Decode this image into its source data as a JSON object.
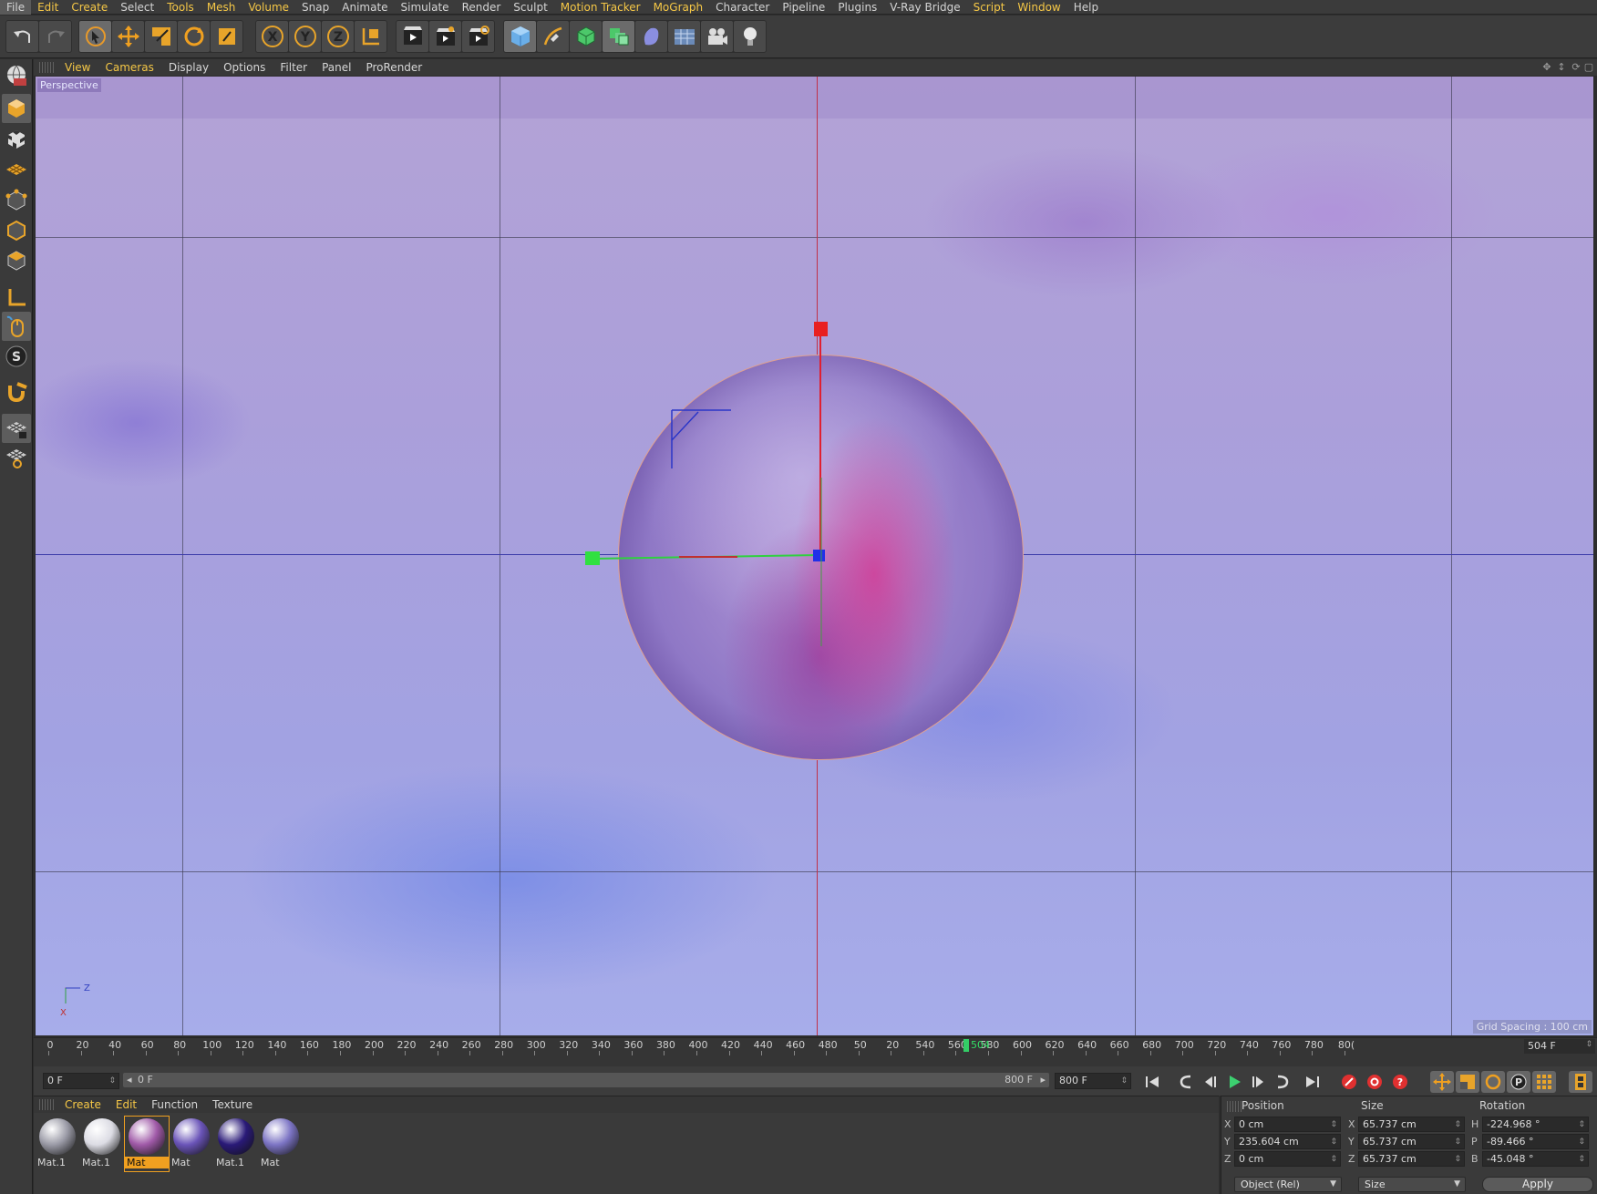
{
  "menubar": {
    "items": [
      {
        "label": "File",
        "hl": false
      },
      {
        "label": "Edit",
        "hl": true
      },
      {
        "label": "Create",
        "hl": true
      },
      {
        "label": "Select",
        "hl": false
      },
      {
        "label": "Tools",
        "hl": true
      },
      {
        "label": "Mesh",
        "hl": true
      },
      {
        "label": "Volume",
        "hl": true
      },
      {
        "label": "Snap",
        "hl": false
      },
      {
        "label": "Animate",
        "hl": false
      },
      {
        "label": "Simulate",
        "hl": false
      },
      {
        "label": "Render",
        "hl": false
      },
      {
        "label": "Sculpt",
        "hl": false
      },
      {
        "label": "Motion Tracker",
        "hl": true
      },
      {
        "label": "MoGraph",
        "hl": true
      },
      {
        "label": "Character",
        "hl": false
      },
      {
        "label": "Pipeline",
        "hl": false
      },
      {
        "label": "Plugins",
        "hl": false
      },
      {
        "label": "V-Ray Bridge",
        "hl": false
      },
      {
        "label": "Script",
        "hl": true
      },
      {
        "label": "Window",
        "hl": true
      },
      {
        "label": "Help",
        "hl": false
      }
    ]
  },
  "toolbar": {
    "icons": [
      "undo-icon",
      "redo-icon",
      "live-selection-icon",
      "move-icon",
      "scale-icon",
      "rotate-icon",
      "recent-tool-icon",
      "x-axis-lock-icon",
      "y-axis-lock-icon",
      "z-axis-lock-icon",
      "coordinate-system-icon",
      "render-view-icon",
      "render-picture-viewer-icon",
      "render-settings-icon",
      "cube-icon",
      "pen-icon",
      "subdivision-icon",
      "array-icon",
      "deformer-icon",
      "floor-icon",
      "camera-icon",
      "light-icon"
    ]
  },
  "viewport": {
    "menus": [
      "View",
      "Cameras",
      "Display",
      "Options",
      "Filter",
      "Panel",
      "ProRender"
    ],
    "menus_hl": [
      true,
      true,
      false,
      false,
      false,
      false,
      false
    ],
    "label": "Perspective",
    "grid_spacing": "Grid Spacing : 100 cm",
    "axis_x_label": "X",
    "axis_z_label": "Z"
  },
  "timeline": {
    "ticks": [
      "0",
      "20",
      "40",
      "60",
      "80",
      "100",
      "120",
      "140",
      "160",
      "180",
      "200",
      "220",
      "240",
      "260",
      "280",
      "300",
      "320",
      "340",
      "360",
      "380",
      "400",
      "420",
      "440",
      "460",
      "480",
      "50",
      "20",
      "540",
      "560",
      "580",
      "600",
      "620",
      "640",
      "660",
      "680",
      "700",
      "720",
      "740",
      "760",
      "780",
      "80("
    ],
    "current_label": "504",
    "current_frame": "504 F"
  },
  "transport": {
    "start": "0 F",
    "range_start": "0 F",
    "range_end": "800 F",
    "end": "800 F"
  },
  "materials": {
    "menus": [
      "Create",
      "Edit",
      "Function",
      "Texture"
    ],
    "menus_hl": [
      true,
      true,
      false,
      false
    ],
    "items": [
      {
        "name": "Mat.1",
        "color": "#9a9aa6",
        "selected": false
      },
      {
        "name": "Mat.1",
        "color": "#dcdce4",
        "selected": false
      },
      {
        "name": "Mat",
        "color": "#a05aa8",
        "selected": true
      },
      {
        "name": "Mat",
        "color": "#6a54b8",
        "selected": false
      },
      {
        "name": "Mat.1",
        "color": "#2a1a78",
        "selected": false
      },
      {
        "name": "Mat",
        "color": "#7c74c4",
        "selected": false
      }
    ]
  },
  "coords": {
    "headers": {
      "position": "Position",
      "size": "Size",
      "rotation": "Rotation"
    },
    "rows": [
      {
        "axis": "X",
        "pos": "0 cm",
        "size_axis": "X",
        "size": "65.737 cm",
        "rot_axis": "H",
        "rot": "-224.968 °"
      },
      {
        "axis": "Y",
        "pos": "235.604 cm",
        "size_axis": "Y",
        "size": "65.737 cm",
        "rot_axis": "P",
        "rot": "-89.466 °"
      },
      {
        "axis": "Z",
        "pos": "0 cm",
        "size_axis": "Z",
        "size": "65.737 cm",
        "rot_axis": "B",
        "rot": "-45.048 °"
      }
    ],
    "mode": "Object (Rel)",
    "size_mode": "Size",
    "apply": "Apply"
  }
}
